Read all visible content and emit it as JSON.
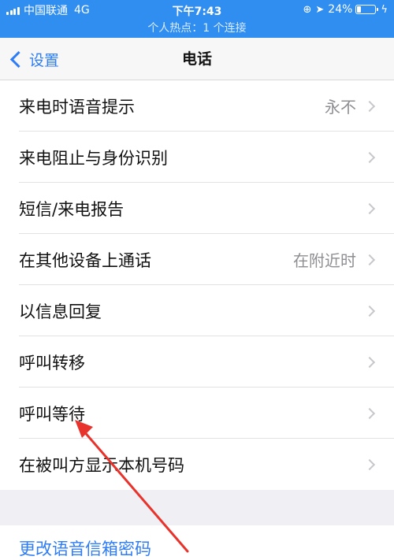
{
  "status_bar": {
    "carrier": "中国联通",
    "network": "4G",
    "time": "下午7:43",
    "battery_text": "24%",
    "battery_level": 0.24,
    "hotspot_text": "个人热点：1 个连接",
    "background_color": "#2f8ef0"
  },
  "nav": {
    "back_label": "设置",
    "title": "电话"
  },
  "settings": {
    "items": [
      {
        "label": "来电时语音提示",
        "value": "永不"
      },
      {
        "label": "来电阻止与身份识别",
        "value": ""
      },
      {
        "label": "短信/来电报告",
        "value": ""
      },
      {
        "label": "在其他设备上通话",
        "value": "在附近时"
      },
      {
        "label": "以信息回复",
        "value": ""
      },
      {
        "label": "呼叫转移",
        "value": ""
      },
      {
        "label": "呼叫等待",
        "value": ""
      },
      {
        "label": "在被叫方显示本机号码",
        "value": ""
      }
    ]
  },
  "voicemail": {
    "change_password_label": "更改语音信箱密码"
  },
  "annotation": {
    "color": "#e8332c",
    "points_to": "呼叫等待"
  },
  "colors": {
    "accent": "#2f7df6",
    "background": "#efeff4",
    "secondary_text": "#8e8e93"
  }
}
